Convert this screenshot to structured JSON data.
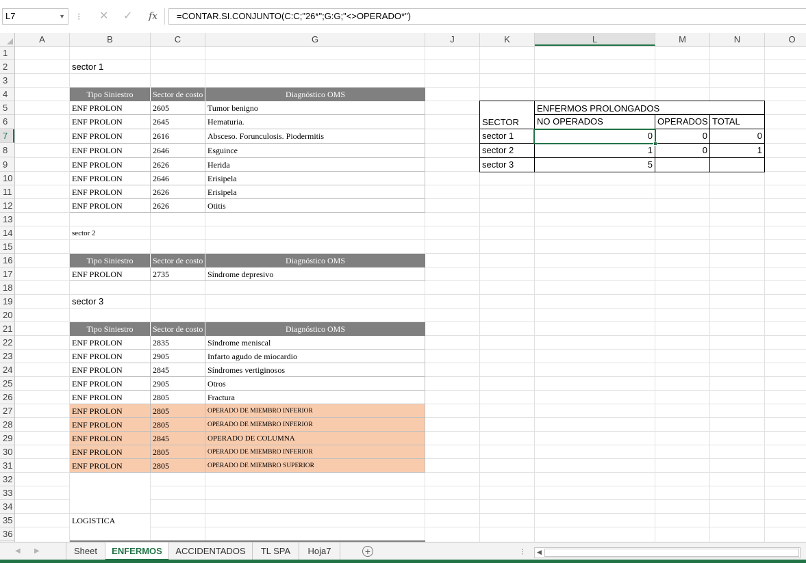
{
  "formula_bar": {
    "name_box": "L7",
    "cancel_icon": "✕",
    "enter_icon": "✓",
    "fx_label": "fx",
    "formula": "=CONTAR.SI.CONJUNTO(C:C;\"26*\";G:G;\"<>OPERADO*\")"
  },
  "columns": [
    "A",
    "B",
    "C",
    "G",
    "J",
    "K",
    "L",
    "M",
    "N",
    "O"
  ],
  "rows": [
    "1",
    "2",
    "3",
    "4",
    "5",
    "6",
    "7",
    "8",
    "9",
    "10",
    "11",
    "12",
    "13",
    "14",
    "15",
    "16",
    "17",
    "18",
    "19",
    "20",
    "21",
    "22",
    "23",
    "24",
    "25",
    "26",
    "27",
    "28",
    "29",
    "30",
    "31",
    "32",
    "33",
    "34",
    "35",
    "36"
  ],
  "active_cell": "L7",
  "labels": {
    "sector1": "sector 1",
    "sector2": "sector 2",
    "sector3": "sector 3",
    "logistica": "LOGISTICA"
  },
  "table_headers": [
    "Tipo Siniestro",
    "Sector de costo",
    "Diagnóstico OMS"
  ],
  "table1": [
    [
      "ENF PROLON",
      "2605",
      "Tumor benigno"
    ],
    [
      "ENF PROLON",
      "2645",
      "Hematuria."
    ],
    [
      "ENF PROLON",
      "2616",
      "Absceso. Forunculosis. Piodermitis"
    ],
    [
      "ENF PROLON",
      "2646",
      "Esguince"
    ],
    [
      "ENF PROLON",
      "2626",
      "Herida"
    ],
    [
      "ENF PROLON",
      "2646",
      "Erisipela"
    ],
    [
      "ENF PROLON",
      "2626",
      "Erisipela"
    ],
    [
      "ENF PROLON",
      "2626",
      "Otitis"
    ]
  ],
  "table2": [
    [
      "ENF PROLON",
      "2735",
      "Síndrome depresivo"
    ]
  ],
  "table3": [
    [
      "ENF PROLON",
      "2835",
      "Síndrome meniscal"
    ],
    [
      "ENF PROLON",
      "2905",
      "Infarto agudo de miocardio"
    ],
    [
      "ENF PROLON",
      "2845",
      "Síndromes vertiginosos"
    ],
    [
      "ENF PROLON",
      "2905",
      "Otros"
    ],
    [
      "ENF PROLON",
      "2805",
      "Fractura"
    ],
    [
      "ENF PROLON",
      "2805",
      "OPERADO DE MIEMBRO INFERIOR"
    ],
    [
      "ENF PROLON",
      "2805",
      "OPERADO DE MIEMBRO INFERIOR"
    ],
    [
      "ENF PROLON",
      "2845",
      "OPERADO DE COLUMNA"
    ],
    [
      "ENF PROLON",
      "2805",
      "OPERADO DE MIEMBRO INFERIOR"
    ],
    [
      "ENF PROLON",
      "2805",
      "OPERADO DE MIEMBRO SUPERIOR"
    ]
  ],
  "summary": {
    "title": "ENFERMOS PROLONGADOS",
    "col_sector": "SECTOR",
    "col_no_operados": "NO OPERADOS",
    "col_operados": "OPERADOS",
    "col_total": "TOTAL",
    "rows": [
      {
        "sector": "sector 1",
        "no_operados": "0",
        "operados": "0",
        "total": "0"
      },
      {
        "sector": "sector 2",
        "no_operados": "1",
        "operados": "0",
        "total": "1"
      },
      {
        "sector": "sector 3",
        "no_operados": "5",
        "operados": "",
        "total": ""
      }
    ]
  },
  "sheet_tabs": [
    "Sheet",
    "ENFERMOS",
    "ACCIDENTADOS",
    "TL SPA",
    "Hoja7"
  ],
  "active_tab": "ENFERMOS",
  "add_sheet_icon": "+",
  "colors": {
    "accent": "#217346",
    "header_gray": "#808080",
    "peach": "#f8cbad"
  }
}
